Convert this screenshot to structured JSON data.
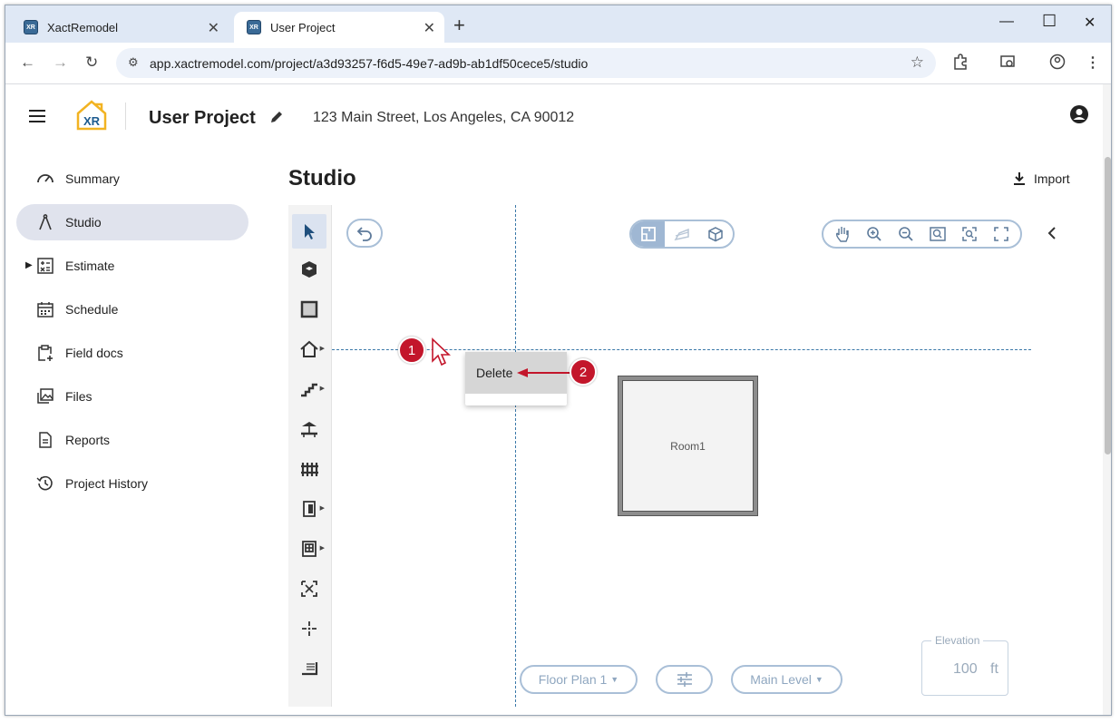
{
  "browser": {
    "tabs": [
      {
        "title": "XactRemodel",
        "favicon": "XR"
      },
      {
        "title": "User Project",
        "favicon": "XR"
      }
    ],
    "new_tab_label": "+",
    "url": "app.xactremodel.com/project/a3d93257-f6d5-49e7-ad9b-ab1df50cece5/studio"
  },
  "header": {
    "logo_text": "XR",
    "project_title": "User Project",
    "address": "123 Main Street, Los Angeles, CA 90012"
  },
  "sidebar": {
    "items": [
      {
        "label": "Summary",
        "icon": "gauge-icon"
      },
      {
        "label": "Studio",
        "icon": "compass-icon",
        "active": true
      },
      {
        "label": "Estimate",
        "icon": "calculator-icon",
        "expandable": true
      },
      {
        "label": "Schedule",
        "icon": "calendar-icon"
      },
      {
        "label": "Field docs",
        "icon": "clipboard-add-icon"
      },
      {
        "label": "Files",
        "icon": "images-icon"
      },
      {
        "label": "Reports",
        "icon": "document-icon"
      },
      {
        "label": "Project History",
        "icon": "history-icon"
      }
    ]
  },
  "studio": {
    "title": "Studio",
    "import_label": "Import",
    "room_label": "Room1",
    "context_menu": {
      "delete_label": "Delete"
    },
    "annotations": {
      "badge1": "1",
      "badge2": "2"
    },
    "floor_plan_label": "Floor Plan 1",
    "level_label": "Main Level",
    "elevation": {
      "label": "Elevation",
      "value": "100",
      "unit": "ft"
    }
  },
  "colors": {
    "accent": "#3a78a8",
    "badge": "#c3162b",
    "active_nav": "#e0e3ed"
  }
}
